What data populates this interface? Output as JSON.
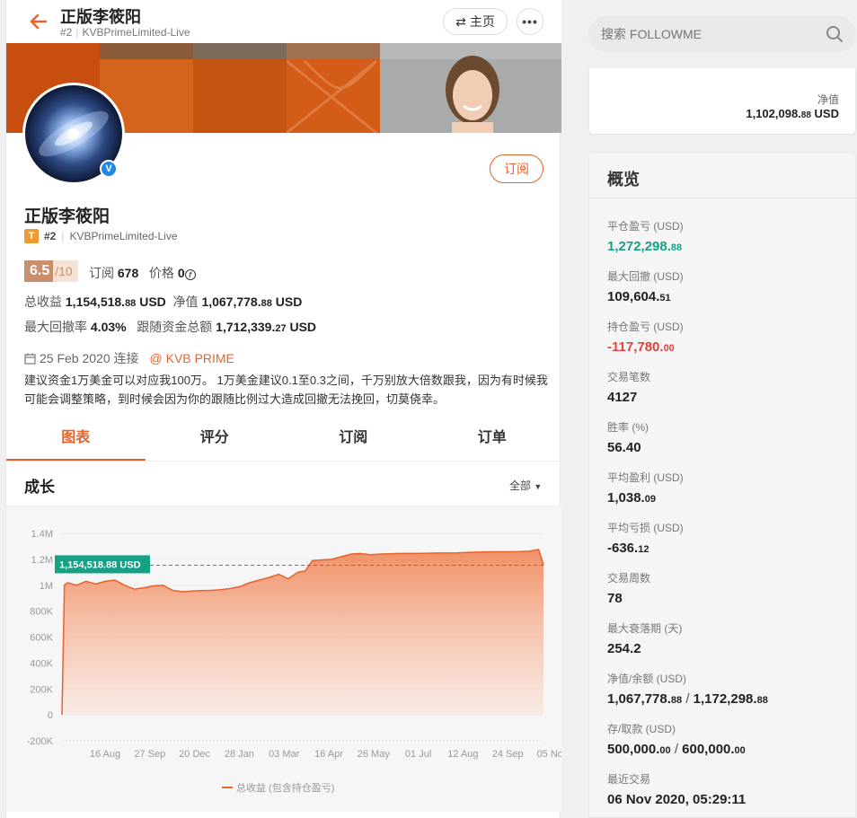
{
  "header": {
    "title": "正版李筱阳",
    "rank": "#2",
    "broker": "KVBPrimeLimited-Live",
    "home_label": "主页",
    "more_label": "•••"
  },
  "profile": {
    "name": "正版李筱阳",
    "tier_badge": "T",
    "rank": "#2",
    "broker": "KVBPrimeLimited-Live",
    "subscribe_label": "订阅",
    "verified_mark": "V",
    "score": "6.5",
    "score_max": "/10",
    "subscribers_label": "订阅",
    "subscribers": "678",
    "price_label": "价格",
    "price": "0"
  },
  "stats": {
    "total_profit_label": "总收益",
    "total_profit_main": "1,154,518.",
    "total_profit_dec": "88",
    "total_profit_unit": "USD",
    "equity_label": "净值",
    "equity_main": "1,067,778.",
    "equity_dec": "88",
    "equity_unit": "USD",
    "max_dd_label": "最大回撤率",
    "max_dd": "4.03%",
    "follow_funds_label": "跟随资金总额",
    "follow_funds_main": "1,712,339.",
    "follow_funds_dec": "27",
    "follow_funds_unit": "USD"
  },
  "since": {
    "date": "25 Feb 2020 连接",
    "broker_link": "@ KVB PRIME"
  },
  "description": "建议资金1万美金可以对应我100万。 1万美金建议0.1至0.3之间，千万别放大倍数跟我，因为有时候我可能会调整策略，到时候会因为你的跟随比例过大造成回撤无法挽回，切莫侥幸。",
  "tabs": [
    {
      "label": "图表",
      "active": true
    },
    {
      "label": "评分",
      "active": false
    },
    {
      "label": "订阅",
      "active": false
    },
    {
      "label": "订单",
      "active": false
    }
  ],
  "growth": {
    "title": "成长",
    "filter": "全部"
  },
  "chart_data": {
    "type": "area",
    "title": "",
    "y_tick_labels": [
      "1.4M",
      "1.2M",
      "1M",
      "800K",
      "600K",
      "400K",
      "200K",
      "0",
      "-200K"
    ],
    "x_tick_labels": [
      "16 Aug",
      "27 Sep",
      "20 Dec",
      "28 Jan",
      "03 Mar",
      "16 Apr",
      "26 May",
      "01 Jul",
      "12 Aug",
      "24 Sep",
      "05 Nov"
    ],
    "ylim": [
      -200000,
      1400000
    ],
    "x": [
      0,
      0.005,
      0.012,
      0.03,
      0.05,
      0.07,
      0.09,
      0.11,
      0.13,
      0.15,
      0.17,
      0.19,
      0.21,
      0.23,
      0.25,
      0.27,
      0.29,
      0.31,
      0.33,
      0.35,
      0.37,
      0.39,
      0.41,
      0.43,
      0.45,
      0.47,
      0.49,
      0.505,
      0.52,
      0.54,
      0.56,
      0.58,
      0.6,
      0.62,
      0.64,
      0.66,
      0.7,
      0.74,
      0.78,
      0.82,
      0.86,
      0.9,
      0.94,
      0.97,
      0.99,
      1.0
    ],
    "values": [
      0,
      1000000,
      1020000,
      1000000,
      1030000,
      1010000,
      1030000,
      1040000,
      1000000,
      970000,
      980000,
      995000,
      1000000,
      960000,
      950000,
      955000,
      958000,
      960000,
      965000,
      975000,
      990000,
      1020000,
      1040000,
      1060000,
      1085000,
      1050000,
      1100000,
      1110000,
      1190000,
      1195000,
      1200000,
      1220000,
      1240000,
      1245000,
      1235000,
      1240000,
      1245000,
      1245000,
      1248000,
      1250000,
      1255000,
      1258000,
      1258000,
      1262000,
      1275000,
      1154518.88
    ],
    "marker_value": 1154518.88,
    "marker_label": "1,154,518.88 USD",
    "legend": "总收益 (包含持仓盈亏)",
    "line_color": "#e8622c",
    "marker_color": "#16a085",
    "grid": true
  },
  "search": {
    "placeholder": "搜索 FOLLOWME"
  },
  "net_card": {
    "label": "净值",
    "value_main": "1,102,098.",
    "value_dec": "88",
    "unit": "USD"
  },
  "overview": {
    "title": "概览",
    "items": [
      {
        "label": "平仓盈亏 (USD)",
        "main": "1,272,298.",
        "dec": "88",
        "color": "green"
      },
      {
        "label": "最大回撤 (USD)",
        "main": "109,604.",
        "dec": "51",
        "color": ""
      },
      {
        "label": "持仓盈亏 (USD)",
        "main": "-117,780.",
        "dec": "00",
        "color": "red"
      },
      {
        "label": "交易笔数",
        "main": "4127",
        "dec": "",
        "color": ""
      },
      {
        "label": "胜率 (%)",
        "main": "56.40",
        "dec": "",
        "color": ""
      },
      {
        "label": "平均盈利 (USD)",
        "main": "1,038.",
        "dec": "09",
        "color": ""
      },
      {
        "label": "平均亏损 (USD)",
        "main": "-636.",
        "dec": "12",
        "color": ""
      },
      {
        "label": "交易周数",
        "main": "78",
        "dec": "",
        "color": ""
      },
      {
        "label": "最大衰落期 (天)",
        "main": "254.2",
        "dec": "",
        "color": ""
      },
      {
        "label": "净值/余额 (USD)",
        "main": "1,067,778.",
        "dec": "88",
        "main2": "1,172,298.",
        "dec2": "88",
        "color": ""
      },
      {
        "label": "存/取款 (USD)",
        "main": "500,000.",
        "dec": "00",
        "main2": "600,000.",
        "dec2": "00",
        "color": ""
      },
      {
        "label": "最近交易",
        "main": "06 Nov 2020, 05:29:11",
        "dec": "",
        "color": ""
      }
    ]
  }
}
